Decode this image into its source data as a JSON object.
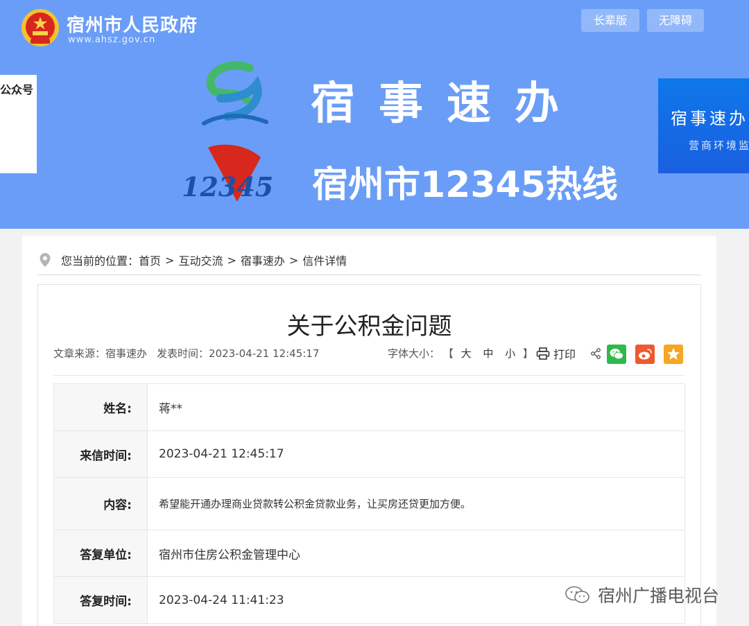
{
  "header": {
    "site_name": "宿州市人民政府",
    "site_domain": "www.ahsz.gov.cn",
    "elder_button": "长辈版",
    "accessible_button": "无障碍"
  },
  "banner": {
    "left_card_text": "公众号",
    "title": "宿事速办",
    "hotline": "宿州市12345热线",
    "logo_number": "12345",
    "right_card_title": "宿事速办",
    "right_card_subtitle": "营商环境监"
  },
  "breadcrumb": {
    "prefix": "您当前的位置：",
    "items": [
      "首页",
      "互动交流",
      "宿事速办",
      "信件详情"
    ]
  },
  "article": {
    "title": "关于公积金问题",
    "source_label": "文章来源：",
    "source": "宿事速办",
    "time_label": "发表时间：",
    "time": "2023-04-21 12:45:17",
    "font_size_label": "字体大小：",
    "font_sizes": [
      "大",
      "中",
      "小"
    ],
    "bracket_open": "【",
    "bracket_close": "】",
    "print_label": "打印"
  },
  "details": [
    {
      "label": "姓名:",
      "value": "蒋**"
    },
    {
      "label": "来信时间:",
      "value": "2023-04-21 12:45:17"
    },
    {
      "label": "内容:",
      "value": "希望能开通办理商业贷款转公积金贷款业务，让买房还贷更加方便。"
    },
    {
      "label": "答复单位:",
      "value": "宿州市住房公积金管理中心"
    },
    {
      "label": "答复时间:",
      "value": "2023-04-24 11:41:23"
    }
  ],
  "watermark": "宿州广播电视台",
  "colors": {
    "banner": "#6a9df7",
    "wechat": "#2fb94a",
    "weibo": "#ed5a2e",
    "favorite": "#f5a623"
  }
}
